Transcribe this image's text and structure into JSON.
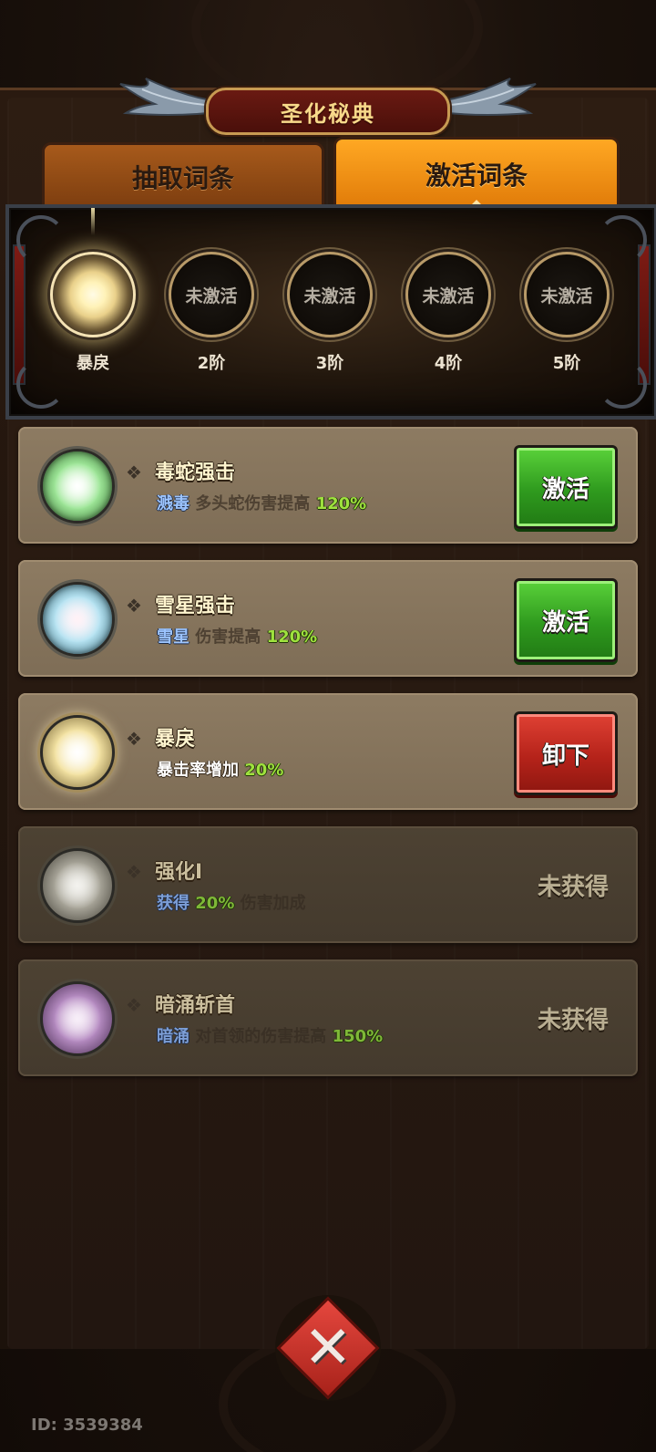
{
  "title": "圣化秘典",
  "tabs": [
    {
      "label": "抽取词条",
      "active": false
    },
    {
      "label": "激活词条",
      "active": true
    }
  ],
  "tiers": [
    {
      "ring_text": "",
      "label": "暴戾",
      "active": true
    },
    {
      "ring_text": "未激活",
      "label": "2阶",
      "active": false
    },
    {
      "ring_text": "未激活",
      "label": "3阶",
      "active": false
    },
    {
      "ring_text": "未激活",
      "label": "4阶",
      "active": false
    },
    {
      "ring_text": "未激活",
      "label": "5阶",
      "active": false
    }
  ],
  "skills": [
    {
      "name": "毒蛇强击",
      "tag": "溅毒",
      "desc": "多头蛇伤害提高",
      "pct": "120%",
      "action": "激活",
      "orb_color": "#8fe08a",
      "state": "available"
    },
    {
      "name": "雪星强击",
      "tag": "雪星",
      "desc": "伤害提高",
      "pct": "120%",
      "action": "激活",
      "orb_color": "#b8e8f4",
      "state": "available"
    },
    {
      "name": "暴戾",
      "tag": "",
      "desc": "暴击率增加",
      "pct": "20%",
      "action": "卸下",
      "orb_color": "#fff1b6",
      "state": "equipped"
    },
    {
      "name": "强化I",
      "tag": "",
      "desc": "获得",
      "pct": "20%",
      "desc2": "伤害加成",
      "action": "未获得",
      "orb_color": "#d8d6cc",
      "state": "locked"
    },
    {
      "name": "暗涌斩首",
      "tag": "暗涌",
      "desc": "对首领的伤害提高",
      "pct": "150%",
      "action": "未获得",
      "orb_color": "#cda8d8",
      "state": "locked"
    }
  ],
  "footer": {
    "id_text": "ID: 3539384"
  },
  "icons": {
    "close": "close-x-icon",
    "bullet": "diamond-cluster-icon",
    "wings": "wing-icon"
  }
}
